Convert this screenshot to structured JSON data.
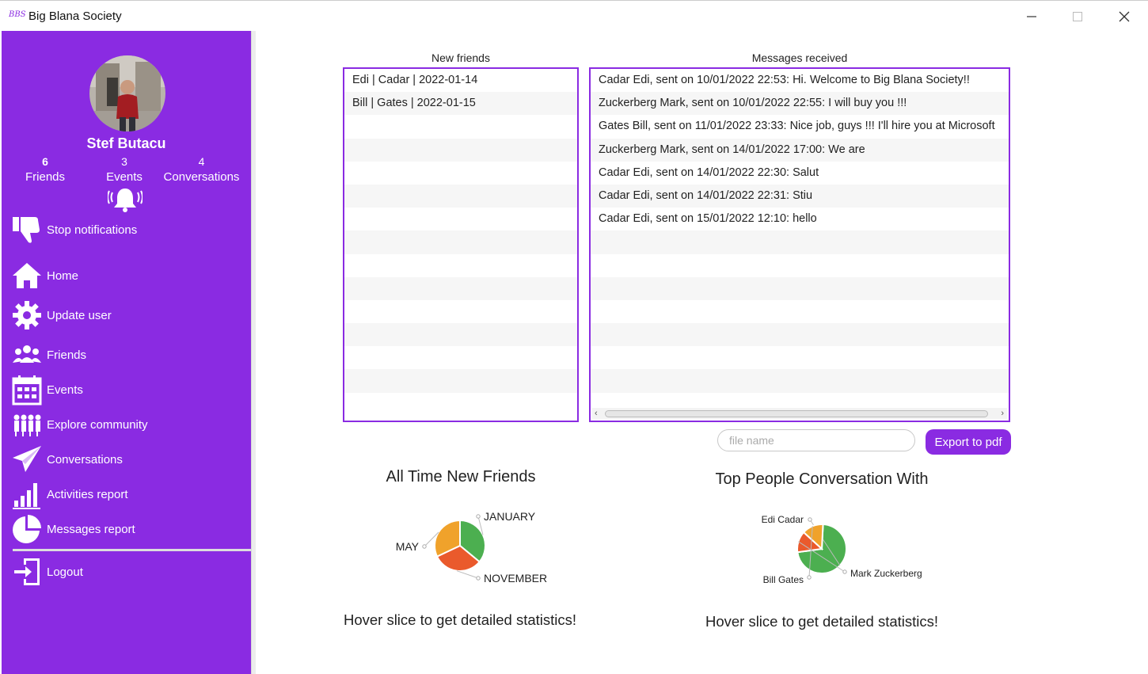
{
  "window": {
    "logo_text": "BBS",
    "title": "Big Blana Society"
  },
  "sidebar": {
    "user_name": "Stef Butacu",
    "stats": {
      "friends_count": "6",
      "friends_label": "Friends",
      "events_count": "3",
      "events_label": "Events",
      "conversations_count": "4",
      "conversations_label": "Conversations"
    },
    "items": [
      {
        "label": "Stop notifications",
        "icon": "thumbs-down-icon"
      },
      {
        "label": "Home",
        "icon": "home-icon"
      },
      {
        "label": "Update user",
        "icon": "gear-icon"
      },
      {
        "label": "Friends",
        "icon": "people-icon"
      },
      {
        "label": "Events",
        "icon": "calendar-icon"
      },
      {
        "label": "Explore community",
        "icon": "community-icon"
      },
      {
        "label": "Conversations",
        "icon": "paper-plane-icon"
      },
      {
        "label": "Activities report",
        "icon": "bar-chart-icon"
      },
      {
        "label": "Messages report",
        "icon": "pie-chart-icon"
      },
      {
        "label": "Logout",
        "icon": "logout-icon"
      }
    ]
  },
  "new_friends": {
    "title": "New friends",
    "rows": [
      "Edi | Cadar | 2022-01-14",
      "Bill | Gates | 2022-01-15"
    ]
  },
  "messages": {
    "title": "Messages received",
    "rows": [
      "Cadar Edi, sent on 10/01/2022 22:53: Hi. Welcome to Big Blana Society!!",
      "Zuckerberg Mark, sent on 10/01/2022 22:55: I will buy you !!!",
      "Gates Bill, sent on 11/01/2022 23:33: Nice job, guys !!! I'll hire you at Microsoft",
      "Zuckerberg Mark, sent on 14/01/2022 17:00: We are",
      "Cadar Edi, sent on 14/01/2022 22:30: Salut",
      "Cadar Edi, sent on 14/01/2022 22:31: Stiu",
      "Cadar Edi, sent on 15/01/2022 12:10: hello"
    ]
  },
  "export": {
    "placeholder": "file name",
    "button_label": "Export to pdf"
  },
  "hover_hint": "Hover slice to get detailed statistics!",
  "chart_data": [
    {
      "type": "pie",
      "title": "All Time New Friends",
      "categories": [
        "JANUARY",
        "NOVEMBER",
        "MAY"
      ],
      "values": [
        36,
        32,
        32
      ],
      "colors": [
        "#4caf50",
        "#ea5a2c",
        "#f0a22b"
      ]
    },
    {
      "type": "pie",
      "title": "Top People Conversation With",
      "categories": [
        "Edi Cadar",
        "Mark Zuckerberg",
        "Bill Gates"
      ],
      "values": [
        72,
        14,
        14
      ],
      "colors": [
        "#4caf50",
        "#ea5a2c",
        "#f0a22b"
      ]
    }
  ]
}
